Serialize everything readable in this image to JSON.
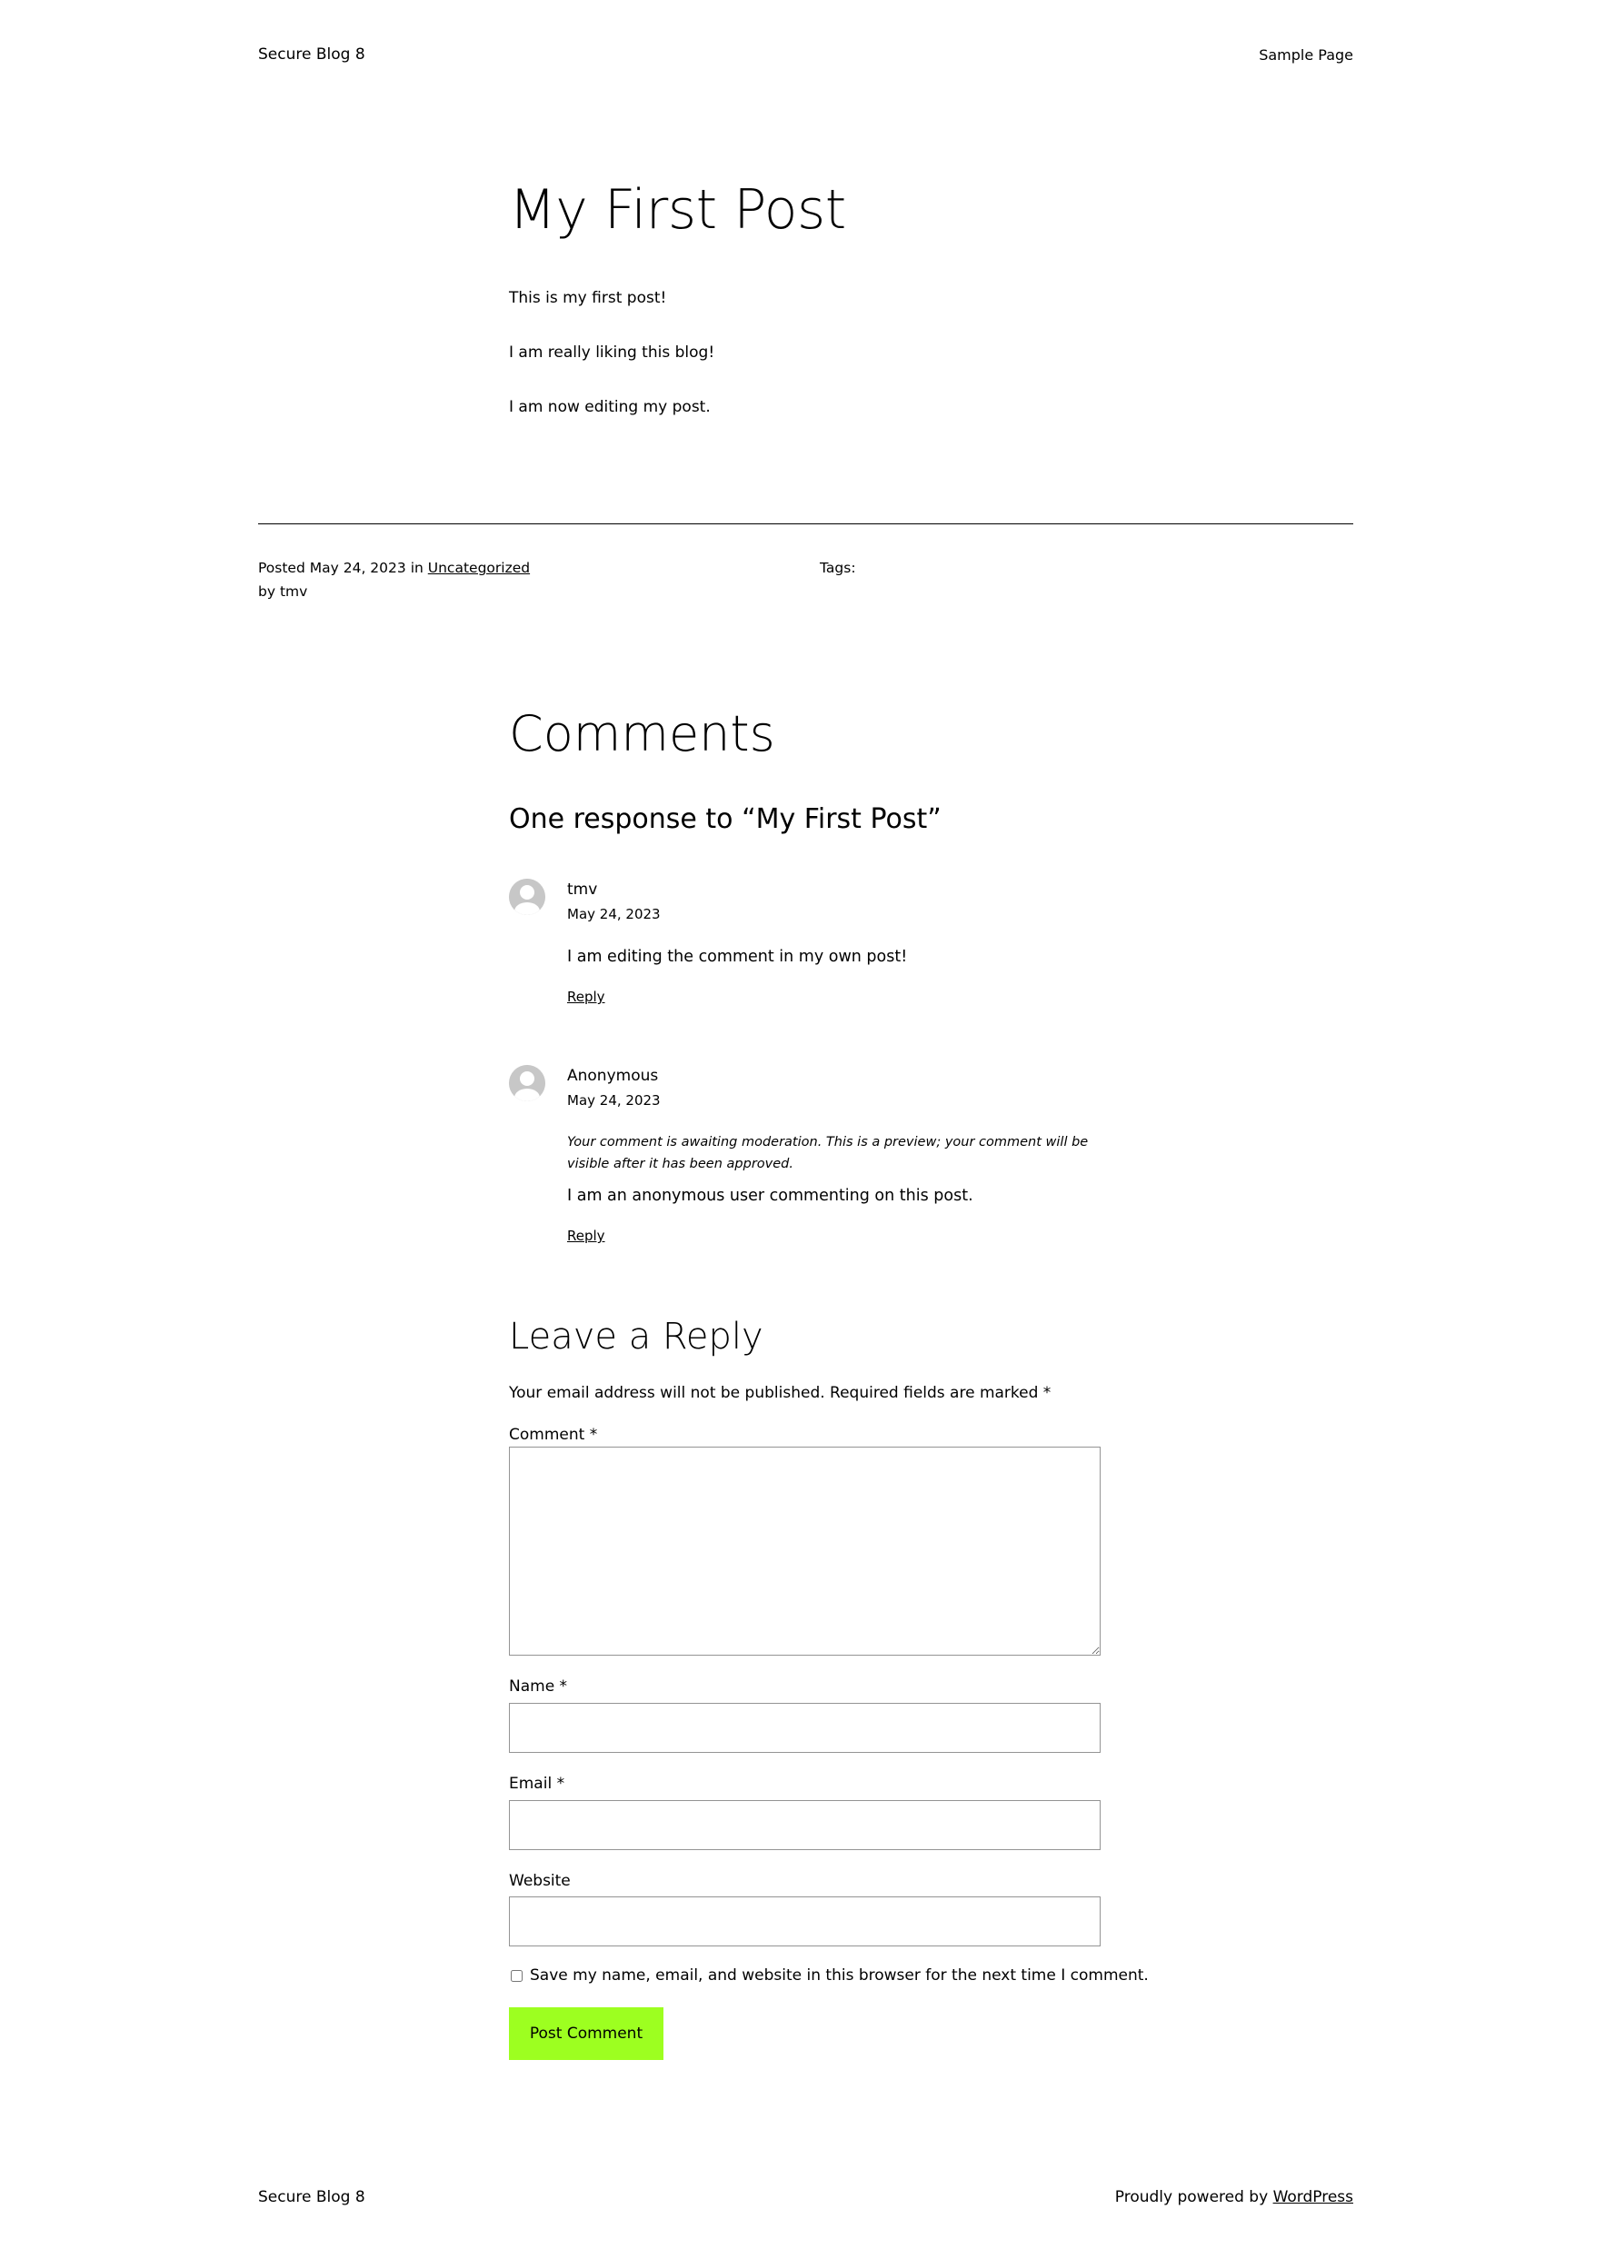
{
  "header": {
    "site_title": "Secure Blog 8",
    "nav": [
      "Sample Page"
    ]
  },
  "post": {
    "title": "My First Post",
    "paragraphs": [
      "This is my first post!",
      "I am really liking this blog!",
      "I am now editing my post."
    ],
    "meta": {
      "posted_prefix": "Posted",
      "date": "May 24, 2023",
      "in_word": "in",
      "category": "Uncategorized",
      "by_line": "by tmv",
      "tags_label": "Tags:"
    }
  },
  "comments": {
    "title": "Comments",
    "responses_title": "One response to “My First Post”",
    "items": [
      {
        "author": "tmv",
        "date": "May 24, 2023",
        "awaiting": "",
        "text": "I am editing the comment in my own post!",
        "reply_label": "Reply"
      },
      {
        "author": "Anonymous",
        "date": "May 24, 2023",
        "awaiting": "Your comment is awaiting moderation. This is a preview; your comment will be visible after it has been approved.",
        "text": "I am an anonymous user commenting on this post.",
        "reply_label": "Reply"
      }
    ]
  },
  "reply_form": {
    "title": "Leave a Reply",
    "notes": "Your email address will not be published. Required fields are marked *",
    "comment_label": "Comment *",
    "name_label": "Name *",
    "email_label": "Email *",
    "website_label": "Website",
    "comment_value": "",
    "name_value": "",
    "email_value": "",
    "website_value": "",
    "cookies_label": "Save my name, email, and website in this browser for the next time I comment.",
    "cookies_checked": false,
    "submit_label": "Post Comment"
  },
  "footer": {
    "site_title": "Secure Blog 8",
    "powered_prefix": "Proudly powered by",
    "powered_link": "WordPress"
  },
  "colors": {
    "button_bg": "#9dff20",
    "avatar_bg": "#c7c7c7",
    "separator": "#000000"
  }
}
